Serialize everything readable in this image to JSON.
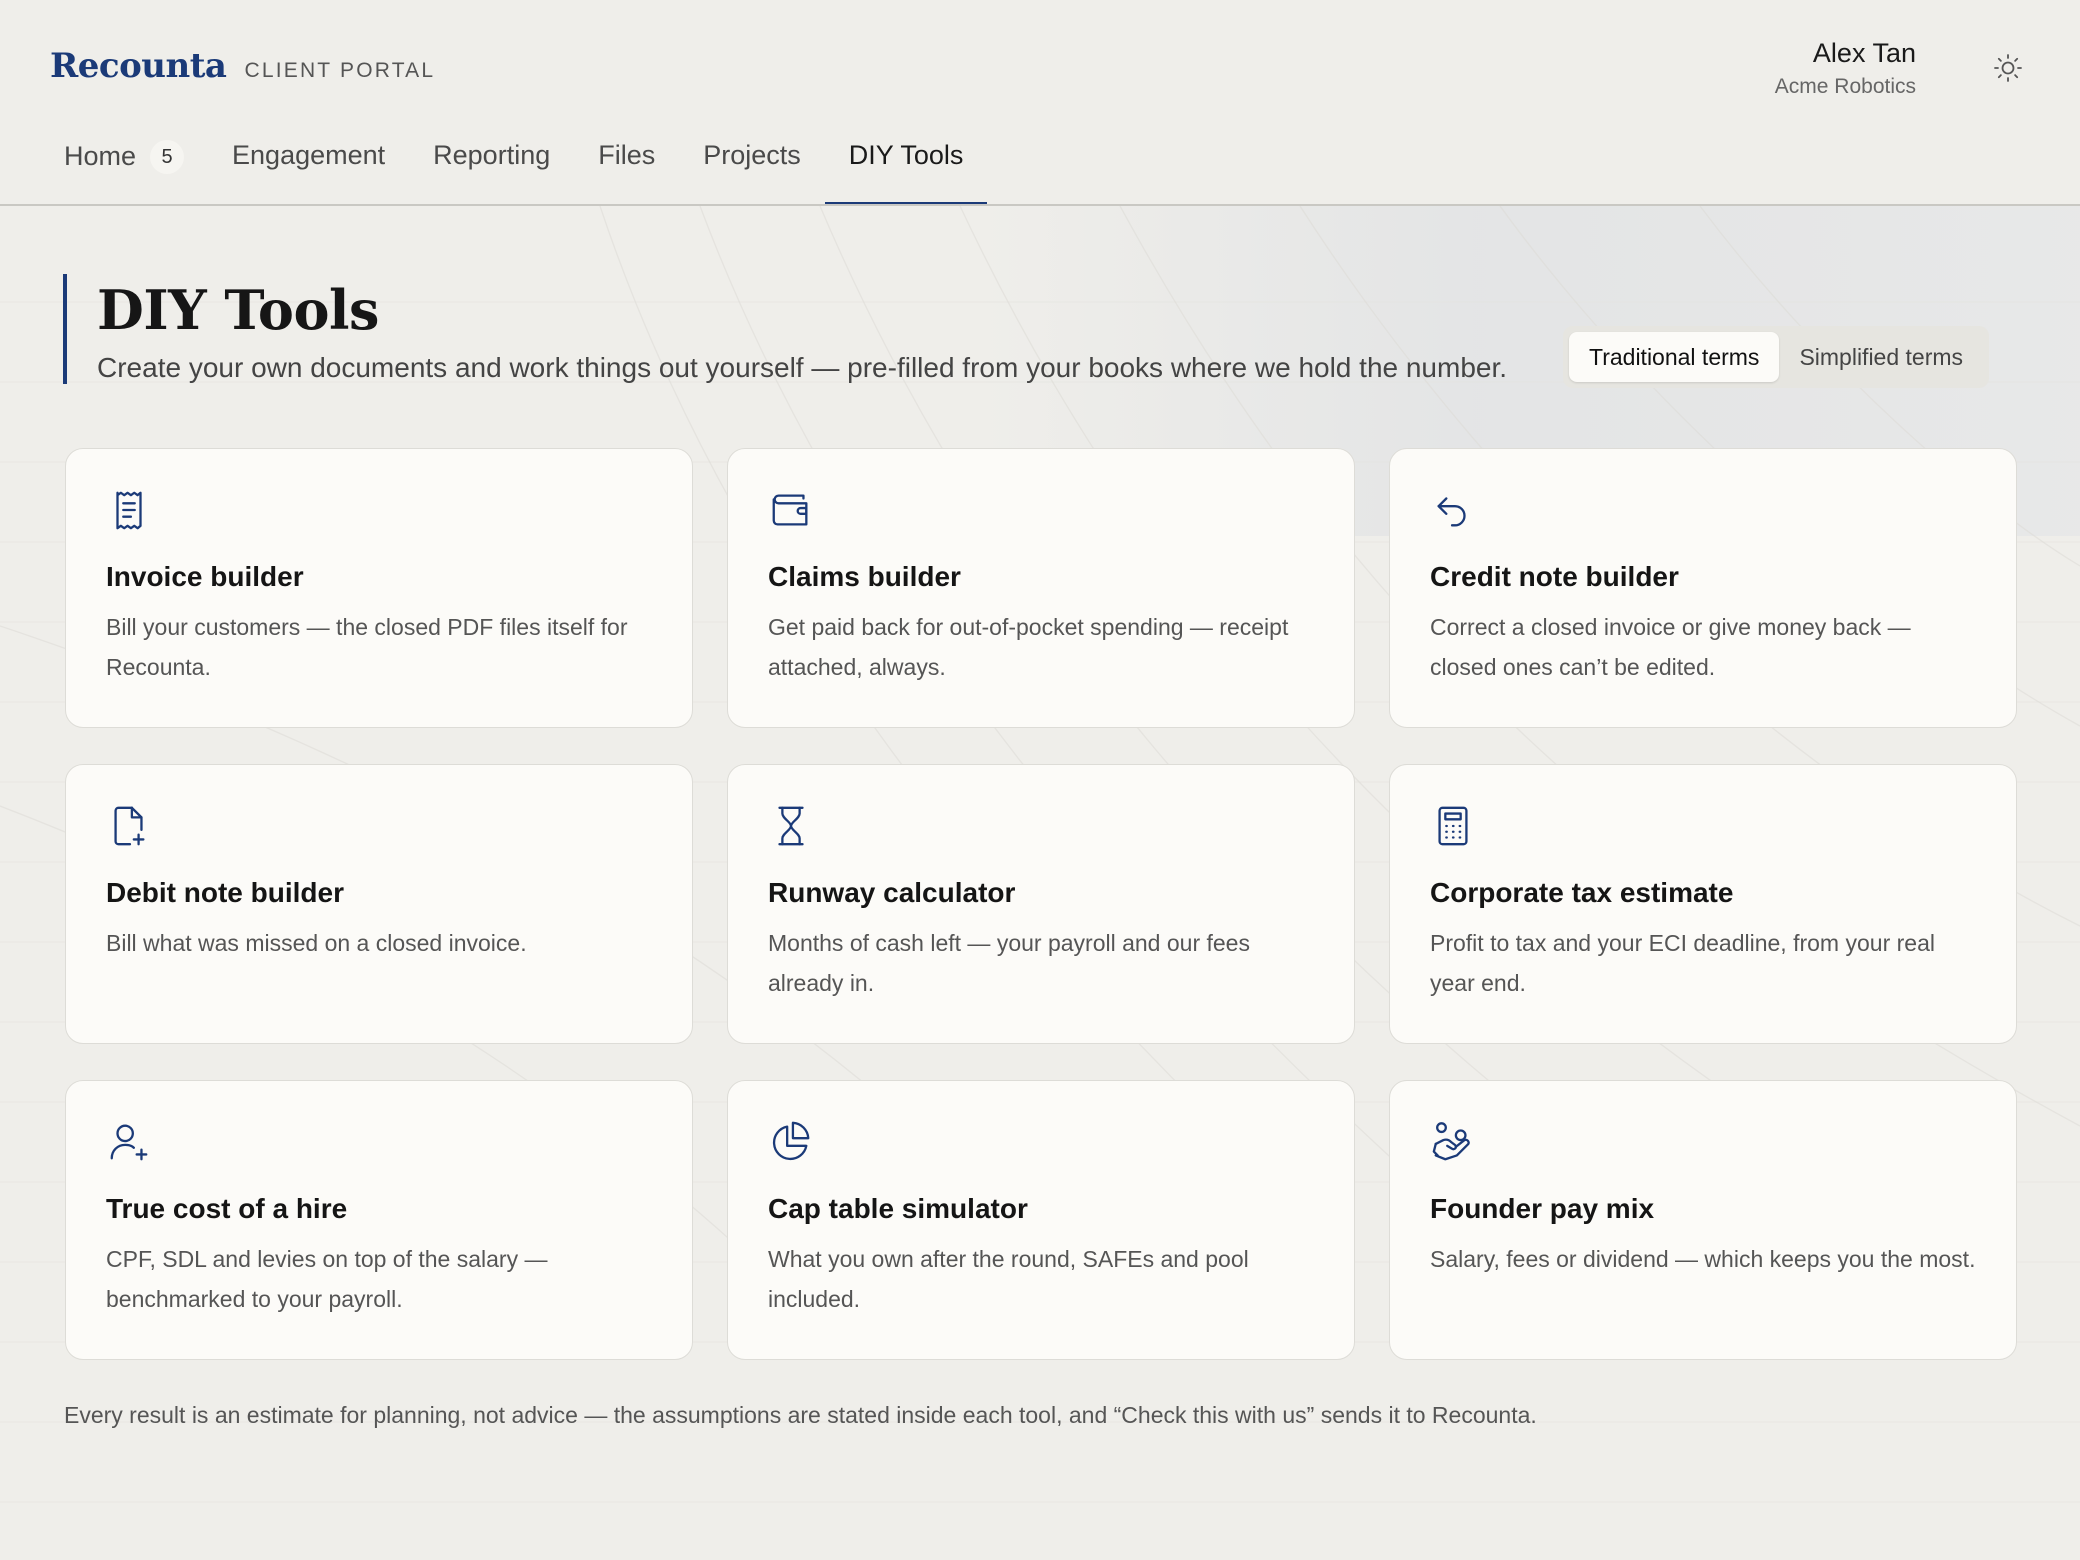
{
  "brand": {
    "logo": "Recounta",
    "portal_label": "CLIENT PORTAL"
  },
  "user": {
    "name": "Alex Tan",
    "org": "Acme Robotics"
  },
  "theme_icon": "sun-icon",
  "nav": {
    "tabs": [
      {
        "label": "Home",
        "badge": "5"
      },
      {
        "label": "Engagement"
      },
      {
        "label": "Reporting"
      },
      {
        "label": "Files"
      },
      {
        "label": "Projects"
      },
      {
        "label": "DIY Tools",
        "active": true
      }
    ]
  },
  "page": {
    "title": "DIY Tools",
    "subtitle": "Create your own documents and work things out yourself — pre-filled from your books where we hold the number.",
    "toggle": {
      "options": [
        "Traditional terms",
        "Simplified terms"
      ],
      "selected": "Traditional terms"
    }
  },
  "tools": [
    {
      "icon": "receipt-icon",
      "title": "Invoice builder",
      "desc": "Bill your customers — the closed PDF files itself for Recounta."
    },
    {
      "icon": "wallet-icon",
      "title": "Claims builder",
      "desc": "Get paid back for out-of-pocket spending — receipt attached, always."
    },
    {
      "icon": "undo-arrow-icon",
      "title": "Credit note builder",
      "desc": "Correct a closed invoice or give money back — closed ones can’t be edited."
    },
    {
      "icon": "file-plus-icon",
      "title": "Debit note builder",
      "desc": "Bill what was missed on a closed invoice."
    },
    {
      "icon": "hourglass-icon",
      "title": "Runway calculator",
      "desc": "Months of cash left — your payroll and our fees already in."
    },
    {
      "icon": "calculator-icon",
      "title": "Corporate tax estimate",
      "desc": "Profit to tax and your ECI deadline, from your real year end."
    },
    {
      "icon": "user-plus-icon",
      "title": "True cost of a hire",
      "desc": "CPF, SDL and levies on top of the salary — benchmarked to your payroll."
    },
    {
      "icon": "pie-chart-icon",
      "title": "Cap table simulator",
      "desc": "What you own after the round, SAFEs and pool included."
    },
    {
      "icon": "hand-coins-icon",
      "title": "Founder pay mix",
      "desc": "Salary, fees or dividend — which keeps you the most."
    }
  ],
  "footer": "Every result is an estimate for planning, not advice — the assumptions are stated inside each tool, and “Check this with us” sends it to Recounta.",
  "colors": {
    "accent": "#1b3a78",
    "background": "#efeeea",
    "card": "#fcfbf8"
  }
}
